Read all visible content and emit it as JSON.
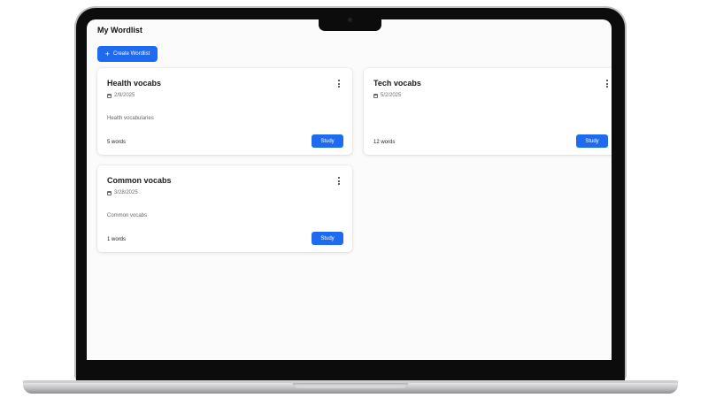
{
  "app": {
    "title": "My Wordlist",
    "create_label": "Create Wordlist",
    "accent": "#1e6bf0"
  },
  "wordlists": [
    {
      "name": "Health vocabs",
      "date": "2/9/2025",
      "description": "Health vocabularies",
      "count": "5 words",
      "study_label": "Study"
    },
    {
      "name": "Tech vocabs",
      "date": "5/2/2025",
      "description": "",
      "count": "12 words",
      "study_label": "Study"
    },
    {
      "name": "Common vocabs",
      "date": "3/28/2025",
      "description": "Common vocabs",
      "count": "1 words",
      "study_label": "Study"
    }
  ],
  "icons": {
    "create": "plus-icon",
    "menu": "more-vertical-icon",
    "date": "calendar-icon"
  }
}
